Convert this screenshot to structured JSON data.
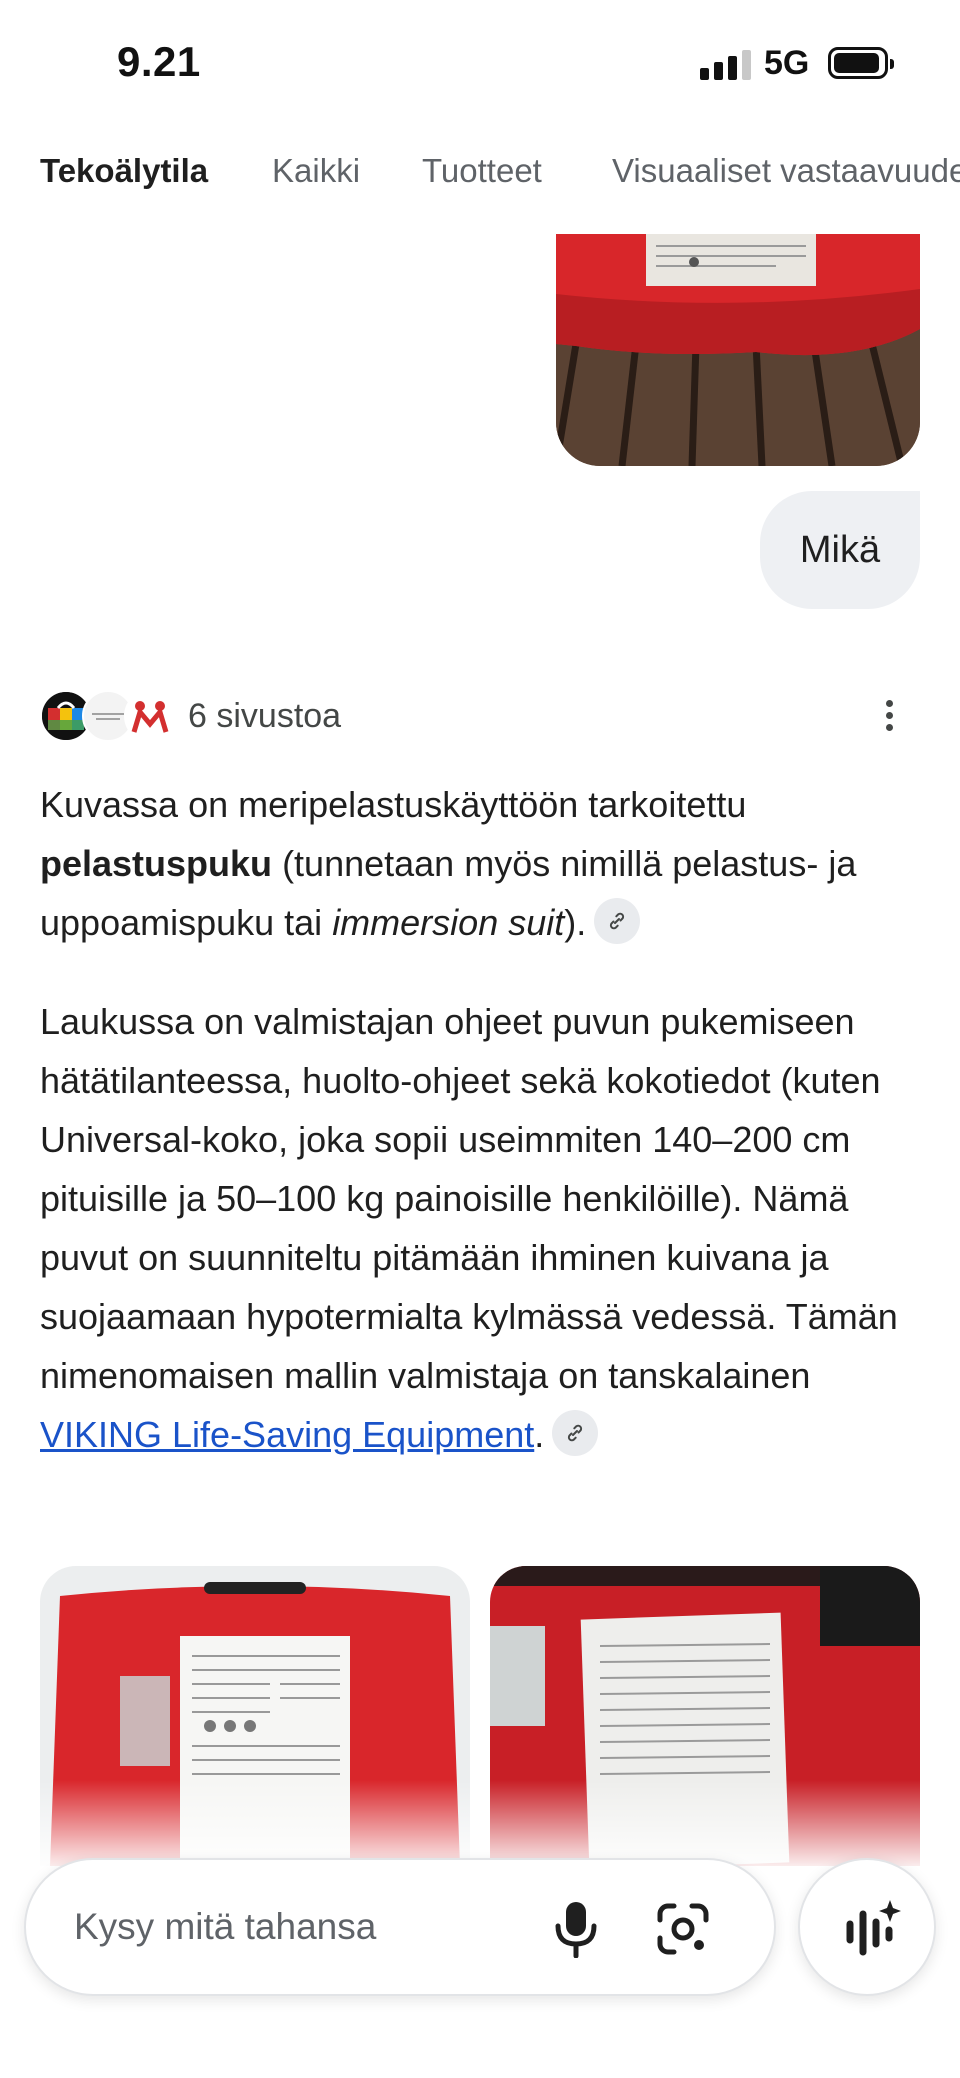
{
  "status_bar": {
    "time": "9.21",
    "network": "5G"
  },
  "tabs": [
    {
      "label": "Tekoälytila",
      "active": true
    },
    {
      "label": "Kaikki",
      "active": false
    },
    {
      "label": "Tuotteet",
      "active": false
    },
    {
      "label": "Visuaaliset vastaavuudet",
      "active": false
    }
  ],
  "user_message": "Mikä",
  "sources": {
    "label": "6 sivustoa"
  },
  "answer": {
    "p1": {
      "before": "Kuvassa on meripelastuskäyttöön tarkoitettu ",
      "bold": "pelastuspuku",
      "middle": " (tunnetaan myös nimillä pelastus- ja uppoamispuku tai ",
      "italic": "immersion suit",
      "after": ")."
    },
    "p2": {
      "text": "Laukussa on valmistajan ohjeet puvun pukemiseen hätätilanteessa, huolto-ohjeet sekä kokotiedot (kuten Universal-koko, joka sopii useimmiten 140–200 cm pituisille ja 50–100 kg painoisille henkilöille). Nämä puvut on suunniteltu pitämään ihminen kuivana ja suojaamaan hypotermialta kylmässä vedessä. Tämän nimenomaisen mallin valmistaja on tanskalainen ",
      "link": "VIKING Life-Saving Equipment",
      "after": "."
    }
  },
  "search": {
    "placeholder": "Kysy mitä tahansa"
  },
  "icons": [
    "signal-icon",
    "battery-icon",
    "link-icon",
    "more-vert-icon",
    "mic-icon",
    "lens-icon",
    "ai-mode-icon"
  ],
  "colors": {
    "link": "#1a53c9",
    "bag_red": "#d62b2b",
    "chip_bg": "#e9ebee"
  }
}
